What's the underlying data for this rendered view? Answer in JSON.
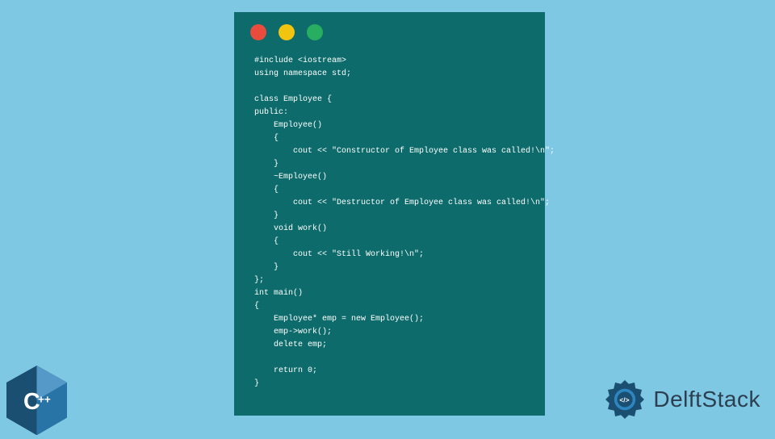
{
  "code": {
    "line1": "#include <iostream>",
    "line2": "using namespace std;",
    "line3": "",
    "line4": "class Employee {",
    "line5": "public:",
    "line6": "    Employee()",
    "line7": "    {",
    "line8": "        cout << \"Constructor of Employee class was called!\\n\";",
    "line9": "    }",
    "line10": "    ~Employee()",
    "line11": "    {",
    "line12": "        cout << \"Destructor of Employee class was called!\\n\";",
    "line13": "    }",
    "line14": "    void work()",
    "line15": "    {",
    "line16": "        cout << \"Still Working!\\n\";",
    "line17": "    }",
    "line18": "};",
    "line19": "int main()",
    "line20": "{",
    "line21": "    Employee* emp = new Employee();",
    "line22": "    emp->work();",
    "line23": "    delete emp;",
    "line24": "",
    "line25": "    return 0;",
    "line26": "}"
  },
  "branding": {
    "cpp_label": "C++",
    "delftstack_label": "DelftStack"
  }
}
